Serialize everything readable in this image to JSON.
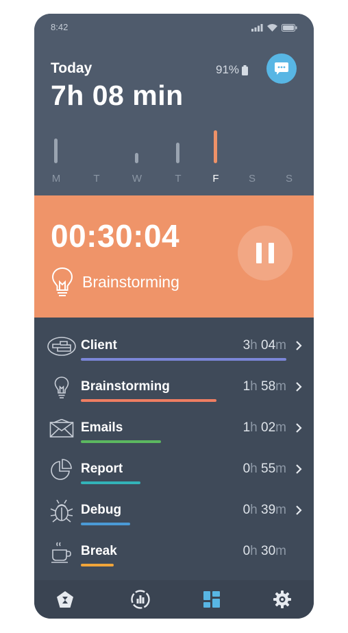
{
  "status_bar": {
    "time": "8:42"
  },
  "header": {
    "today_label": "Today",
    "today_total": "7h 08 min",
    "battery_percent": "91%"
  },
  "week": {
    "days": [
      {
        "label": "M",
        "level": 0.75,
        "active": false
      },
      {
        "label": "T",
        "level": 0.0,
        "active": false
      },
      {
        "label": "W",
        "level": 0.32,
        "active": false
      },
      {
        "label": "T",
        "level": 0.62,
        "active": false
      },
      {
        "label": "F",
        "level": 1.0,
        "active": true
      },
      {
        "label": "S",
        "level": 0.0,
        "active": false
      },
      {
        "label": "S",
        "level": 0.0,
        "active": false
      }
    ]
  },
  "timer": {
    "value": "00:30:04",
    "task": "Brainstorming"
  },
  "tasks": [
    {
      "name": "Client",
      "hours": "3",
      "minutes": "04",
      "h_unit": "h",
      "m_unit": "m",
      "color": "#7b86d8",
      "fraction": 1.0,
      "icon": "client-icon",
      "chevron": true
    },
    {
      "name": "Brainstorming",
      "hours": "1",
      "minutes": "58",
      "h_unit": "h",
      "m_unit": "m",
      "color": "#ef7e62",
      "fraction": 0.66,
      "icon": "lightbulb-icon",
      "chevron": true
    },
    {
      "name": "Emails",
      "hours": "1",
      "minutes": "02",
      "h_unit": "h",
      "m_unit": "m",
      "color": "#5cb860",
      "fraction": 0.39,
      "icon": "envelope-icon",
      "chevron": true
    },
    {
      "name": "Report",
      "hours": "0",
      "minutes": "55",
      "h_unit": "h",
      "m_unit": "m",
      "color": "#33b3b8",
      "fraction": 0.29,
      "icon": "pie-chart-icon",
      "chevron": true
    },
    {
      "name": "Debug",
      "hours": "0",
      "minutes": "39",
      "h_unit": "h",
      "m_unit": "m",
      "color": "#4a9ad6",
      "fraction": 0.24,
      "icon": "bug-icon",
      "chevron": true
    },
    {
      "name": "Break",
      "hours": "0",
      "minutes": "30",
      "h_unit": "h",
      "m_unit": "m",
      "color": "#f0a43a",
      "fraction": 0.16,
      "icon": "coffee-icon",
      "chevron": false
    }
  ],
  "nav": {
    "items": [
      {
        "icon": "hourglass-icon",
        "active": false
      },
      {
        "icon": "stats-icon",
        "active": false
      },
      {
        "icon": "dashboard-icon",
        "active": true
      },
      {
        "icon": "gear-icon",
        "active": false
      }
    ],
    "active_color": "#58b6e4",
    "inactive_color": "#e6eaef"
  }
}
